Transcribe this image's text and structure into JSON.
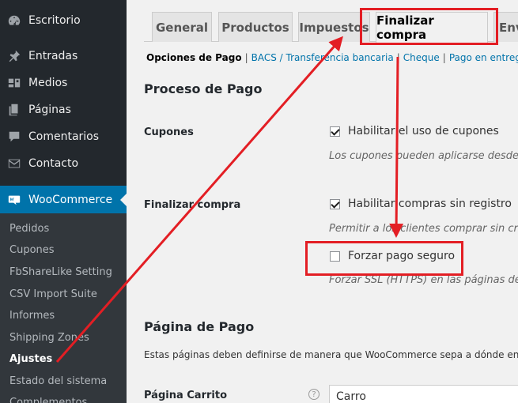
{
  "sidebar": {
    "items": [
      {
        "label": "Escritorio",
        "icon": "dashboard-icon"
      },
      {
        "label": "Entradas",
        "icon": "pin-icon"
      },
      {
        "label": "Medios",
        "icon": "media-icon"
      },
      {
        "label": "Páginas",
        "icon": "pages-icon"
      },
      {
        "label": "Comentarios",
        "icon": "comment-icon"
      },
      {
        "label": "Contacto",
        "icon": "mail-icon"
      },
      {
        "label": "WooCommerce",
        "icon": "woo-icon"
      }
    ],
    "submenu": [
      "Pedidos",
      "Cupones",
      "FbShareLike Setting",
      "CSV Import Suite",
      "Informes",
      "Shipping Zones",
      "Ajustes",
      "Estado del sistema",
      "Complementos"
    ]
  },
  "tabs": [
    "General",
    "Productos",
    "Impuestos",
    "Finalizar compra",
    "Env"
  ],
  "subsubsub": {
    "current": "Opciones de Pago",
    "links": [
      "BACS / Transferencia bancaria",
      "Cheque",
      "Pago en entrega"
    ]
  },
  "sections": {
    "process_title": "Proceso de Pago",
    "coupons_label": "Cupones",
    "coupons_option": "Habilitar el uso de cupones",
    "coupons_desc": "Los cupones pueden aplicarse desde la",
    "checkout_label": "Finalizar compra",
    "guest_option": "Habilitar compras sin registro",
    "guest_desc": "Permitir a los clientes comprar sin cre",
    "ssl_option": "Forzar pago seguro",
    "ssl_desc": "Forzar SSL (HTTPS) en las páginas de p",
    "pages_title": "Página de Pago",
    "pages_desc": "Estas páginas deben definirse de manera que WooCommerce sepa a dónde env",
    "cart_label": "Página Carrito",
    "cart_value": "Carro"
  },
  "colors": {
    "accent": "#0073aa",
    "highlight": "#e31e24"
  }
}
